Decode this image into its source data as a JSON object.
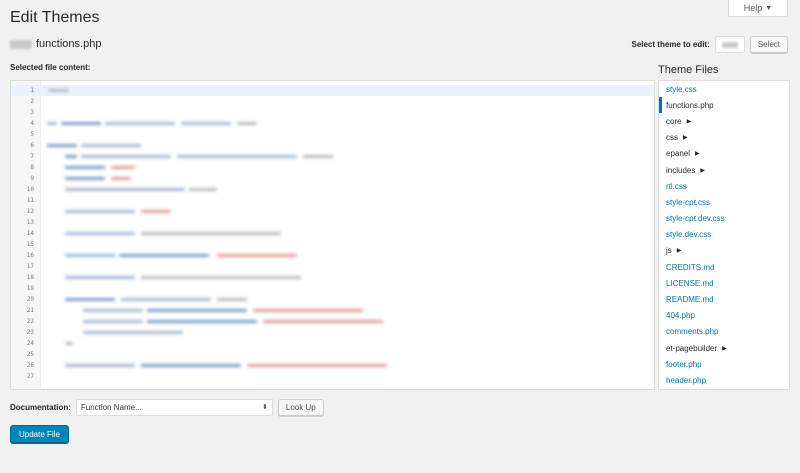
{
  "page": {
    "title": "Edit Themes",
    "help_label": "Help",
    "file_heading": "functions.php",
    "select_theme_label": "Select theme to edit:",
    "select_button": "Select",
    "selected_content_label": "Selected file content:"
  },
  "editor": {
    "line_numbers": [
      "1",
      "2",
      "3",
      "4",
      "5",
      "6",
      "7",
      "8",
      "9",
      "10",
      "11",
      "12",
      "13",
      "14",
      "15",
      "16",
      "17",
      "18",
      "19",
      "20",
      "21",
      "22",
      "23",
      "24",
      "25",
      "26",
      "27"
    ],
    "active_line": 1
  },
  "sidebar": {
    "title": "Theme Files",
    "files": [
      {
        "label": "style.css",
        "type": "file"
      },
      {
        "label": "functions.php",
        "type": "file",
        "current": true
      },
      {
        "label": "core",
        "type": "folder"
      },
      {
        "label": "css",
        "type": "folder"
      },
      {
        "label": "epanel",
        "type": "folder"
      },
      {
        "label": "includes",
        "type": "folder"
      },
      {
        "label": "rtl.css",
        "type": "file"
      },
      {
        "label": "style-cpt.css",
        "type": "file"
      },
      {
        "label": "style-cpt.dev.css",
        "type": "file"
      },
      {
        "label": "style.dev.css",
        "type": "file"
      },
      {
        "label": "js",
        "type": "folder"
      },
      {
        "label": "CREDITS.md",
        "type": "file"
      },
      {
        "label": "LICENSE.md",
        "type": "file"
      },
      {
        "label": "README.md",
        "type": "file"
      },
      {
        "label": "404.php",
        "type": "file"
      },
      {
        "label": "comments.php",
        "type": "file"
      },
      {
        "label": "et-pagebuilder",
        "type": "folder"
      },
      {
        "label": "footer.php",
        "type": "file"
      },
      {
        "label": "header.php",
        "type": "file"
      }
    ]
  },
  "documentation": {
    "label": "Documentation:",
    "select_value": "Function Name...",
    "lookup_button": "Look Up"
  },
  "actions": {
    "update_button": "Update File"
  },
  "colors": {
    "accent": "#0073aa",
    "primary_button": "#0085ba",
    "background": "#f1f1f1"
  }
}
